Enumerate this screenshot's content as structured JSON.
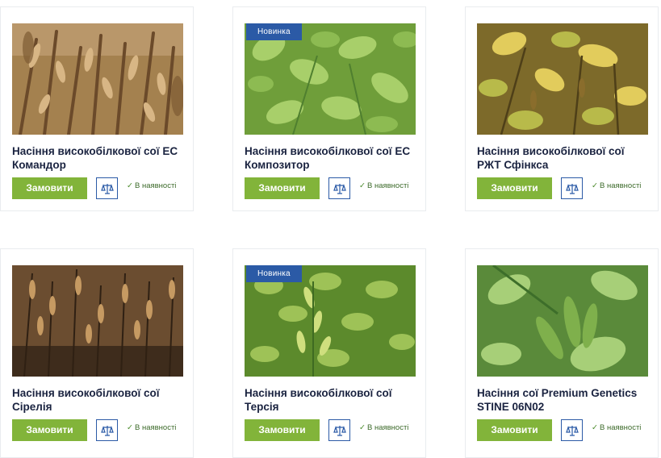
{
  "products": [
    {
      "title_line1": "Насіння високобілкової сої ЕС",
      "title_line2": "Командор",
      "badge": "",
      "order_label": "Замовити",
      "stock_label": "В наявності",
      "check": "✓",
      "image": "soy-dry-pods",
      "palette": [
        "#7a5a3a",
        "#b38d5e",
        "#d9b98a"
      ]
    },
    {
      "title_line1": "Насіння високобілкової сої ЕС",
      "title_line2": "Композитор",
      "badge": "Новинка",
      "order_label": "Замовити",
      "stock_label": "В наявності",
      "check": "✓",
      "image": "soy-green-leaves",
      "palette": [
        "#4f7f2f",
        "#7fb04c",
        "#bcd98a"
      ]
    },
    {
      "title_line1": "Насіння високобілкової сої",
      "title_line2": "РЖТ Сфінкса",
      "badge": "",
      "order_label": "Замовити",
      "stock_label": "В наявності",
      "check": "✓",
      "image": "soy-yellowing-plants",
      "palette": [
        "#6b5a1f",
        "#c9a534",
        "#e8d270"
      ]
    },
    {
      "title_line1": "Насіння високобілкової сої",
      "title_line2": "Сірелія",
      "badge": "",
      "order_label": "Замовити",
      "stock_label": "В наявності",
      "check": "✓",
      "image": "soy-dry-field",
      "palette": [
        "#4a3422",
        "#9a7346",
        "#c8a270"
      ]
    },
    {
      "title_line1": "Насіння високобілкової сої",
      "title_line2": "Терсія",
      "badge": "Новинка",
      "order_label": "Замовити",
      "stock_label": "В наявності",
      "check": "✓",
      "image": "soy-green-pods",
      "palette": [
        "#3f6b22",
        "#7aa83a",
        "#c5dc7a"
      ]
    },
    {
      "title_line1": "Насіння сої Premium Genetics",
      "title_line2": "STINE 06N02",
      "badge": "",
      "order_label": "Замовити",
      "stock_label": "В наявності",
      "check": "✓",
      "image": "soy-green-pods-closeup",
      "palette": [
        "#3d6e2a",
        "#8ab85a",
        "#cfe49b"
      ]
    }
  ],
  "colors": {
    "accent_green": "#82b43a",
    "accent_blue": "#2b5aa6",
    "title_text": "#1a2340",
    "stock_text": "#3c6a2a"
  },
  "icons": {
    "compare": "scales-icon"
  }
}
